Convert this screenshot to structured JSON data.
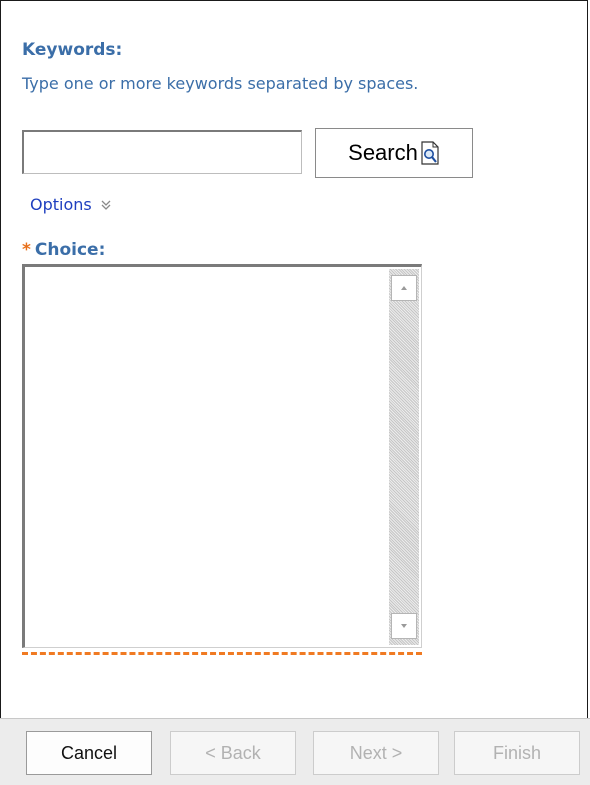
{
  "keywords": {
    "label": "Keywords:",
    "hint": "Type one or more keywords separated by spaces.",
    "value": "",
    "search_label": "Search"
  },
  "options": {
    "label": "Options"
  },
  "choice": {
    "required_marker": "*",
    "label": "Choice:",
    "items": []
  },
  "footer": {
    "cancel": "Cancel",
    "back": "< Back",
    "next": "Next >",
    "finish": "Finish"
  },
  "colors": {
    "label_blue": "#3b6ea8",
    "link_blue": "#1f3fbf",
    "required_orange": "#e8701a"
  }
}
